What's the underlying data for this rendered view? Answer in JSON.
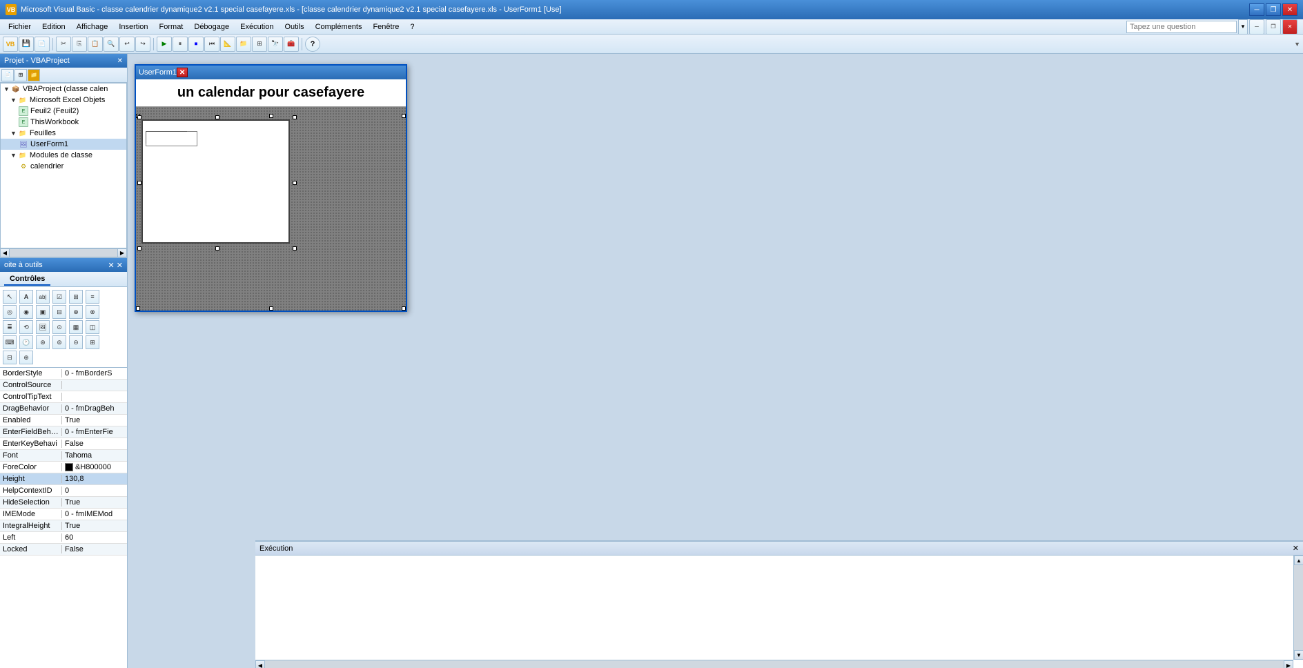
{
  "titlebar": {
    "title": "Microsoft Visual Basic - classe calendrier dynamique2 v2.1 special casefayere.xls - [classe calendrier dynamique2 v2.1 special casefayere.xls - UserForm1 [Use]",
    "icon": "VB",
    "buttons": {
      "minimize": "─",
      "restore": "❐",
      "close": "✕"
    }
  },
  "menubar": {
    "items": [
      "Fichier",
      "Edition",
      "Affichage",
      "Insertion",
      "Format",
      "Débogage",
      "Exécution",
      "Outils",
      "Compléments",
      "Fenêtre",
      "?"
    ]
  },
  "project_panel": {
    "title": "Projet - VBAProject",
    "close": "✕",
    "tree": {
      "root": "VBAProject (classe calen",
      "items": [
        {
          "label": "VBAProject (classe calen",
          "type": "project",
          "indent": 0,
          "expanded": true
        },
        {
          "label": "Microsoft Excel Objets",
          "type": "folder",
          "indent": 1,
          "expanded": true
        },
        {
          "label": "Feuil2 (Feuil2)",
          "type": "excel",
          "indent": 2,
          "expanded": false
        },
        {
          "label": "ThisWorkbook",
          "type": "excel",
          "indent": 2,
          "expanded": false
        },
        {
          "label": "Feuilles",
          "type": "folder",
          "indent": 1,
          "expanded": true
        },
        {
          "label": "UserForm1",
          "type": "form",
          "indent": 2,
          "expanded": false
        },
        {
          "label": "Modules de classe",
          "type": "folder",
          "indent": 1,
          "expanded": true
        },
        {
          "label": "calendrier",
          "type": "module",
          "indent": 2,
          "expanded": false
        }
      ]
    }
  },
  "toolbox": {
    "title": "oite à outils",
    "close": "✕",
    "tabs": [
      {
        "label": "Contrôles",
        "active": true
      }
    ],
    "tools": [
      "A",
      "ab|",
      "☑",
      "⊞",
      "≡",
      "◎",
      "◉",
      "▣",
      "⊟",
      "⊕",
      "⊗",
      "≣",
      "🖼",
      "⊙",
      "▦",
      "◫",
      "⌨",
      "🕐",
      "⊛",
      "⊜",
      "⊝",
      "⊞",
      "⊟"
    ]
  },
  "userform": {
    "title": "UserForm1",
    "header": "un calendar  pour casefayere",
    "close": "✕"
  },
  "properties": {
    "rows": [
      {
        "name": "BorderStyle",
        "value": "0 - fmBorderS"
      },
      {
        "name": "ControlSource",
        "value": ""
      },
      {
        "name": "ControlTipText",
        "value": ""
      },
      {
        "name": "DragBehavior",
        "value": "0 - fmDragBeh"
      },
      {
        "name": "Enabled",
        "value": "True"
      },
      {
        "name": "EnterFieldBehav",
        "value": "0 - fmEnterFie"
      },
      {
        "name": "EnterKeyBehavi",
        "value": "False"
      },
      {
        "name": "Font",
        "value": "Tahoma"
      },
      {
        "name": "ForeColor",
        "value": "&H800000"
      },
      {
        "name": "Height",
        "value": "130,8"
      },
      {
        "name": "HelpContextID",
        "value": "0"
      },
      {
        "name": "HideSelection",
        "value": "True"
      },
      {
        "name": "IMEMode",
        "value": "0 - fmIMEMod"
      },
      {
        "name": "IntegralHeight",
        "value": "True"
      },
      {
        "name": "Left",
        "value": "60"
      },
      {
        "name": "Locked",
        "value": "False"
      }
    ]
  },
  "execution": {
    "title": "Exécution",
    "close": "✕"
  },
  "search": {
    "placeholder": "Tapez une question"
  }
}
